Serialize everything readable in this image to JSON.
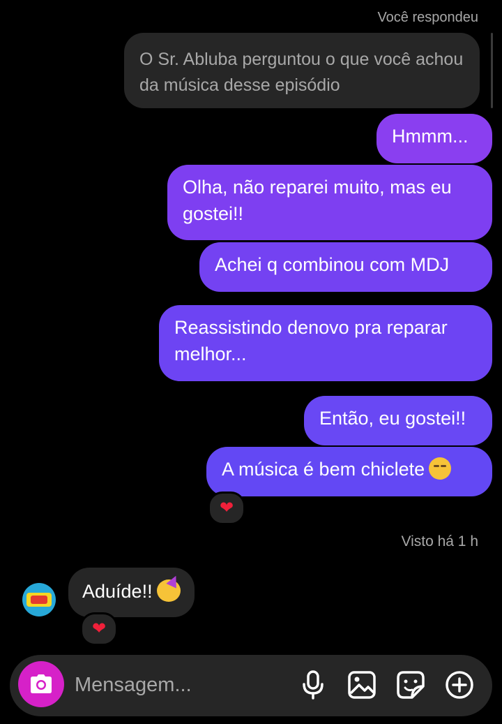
{
  "reply": {
    "label": "Você respondeu",
    "quoted_text": "O Sr. Abluba perguntou o que você achou da música desse episódio"
  },
  "messages_sent": [
    {
      "text": "Hmmm..."
    },
    {
      "text": "Olha, não reparei muito, mas eu gostei!!"
    },
    {
      "text": "Achei q combinou com MDJ"
    },
    {
      "text": "Reassistindo denovo pra reparar melhor..."
    },
    {
      "text": "Então, eu gostei!!"
    },
    {
      "text": "A música é bem chiclete",
      "emoji": "hand-over-mouth-face-icon",
      "reaction": "heart-icon"
    }
  ],
  "seen_status": "Visto há 1 h",
  "message_received": {
    "text": "Aduíde!!",
    "emoji": "partying-face-icon",
    "reaction": "heart-icon"
  },
  "composer": {
    "placeholder": "Mensagem...",
    "icons": [
      "camera-icon",
      "microphone-icon",
      "gallery-icon",
      "sticker-icon",
      "plus-icon"
    ]
  },
  "colors": {
    "background": "#000000",
    "incoming_bubble": "#262626",
    "sent_gradient_top": "#8a3ff0",
    "sent_gradient_bottom": "#6348f4",
    "camera_button": "#d621c8",
    "heart": "#f0203a"
  }
}
